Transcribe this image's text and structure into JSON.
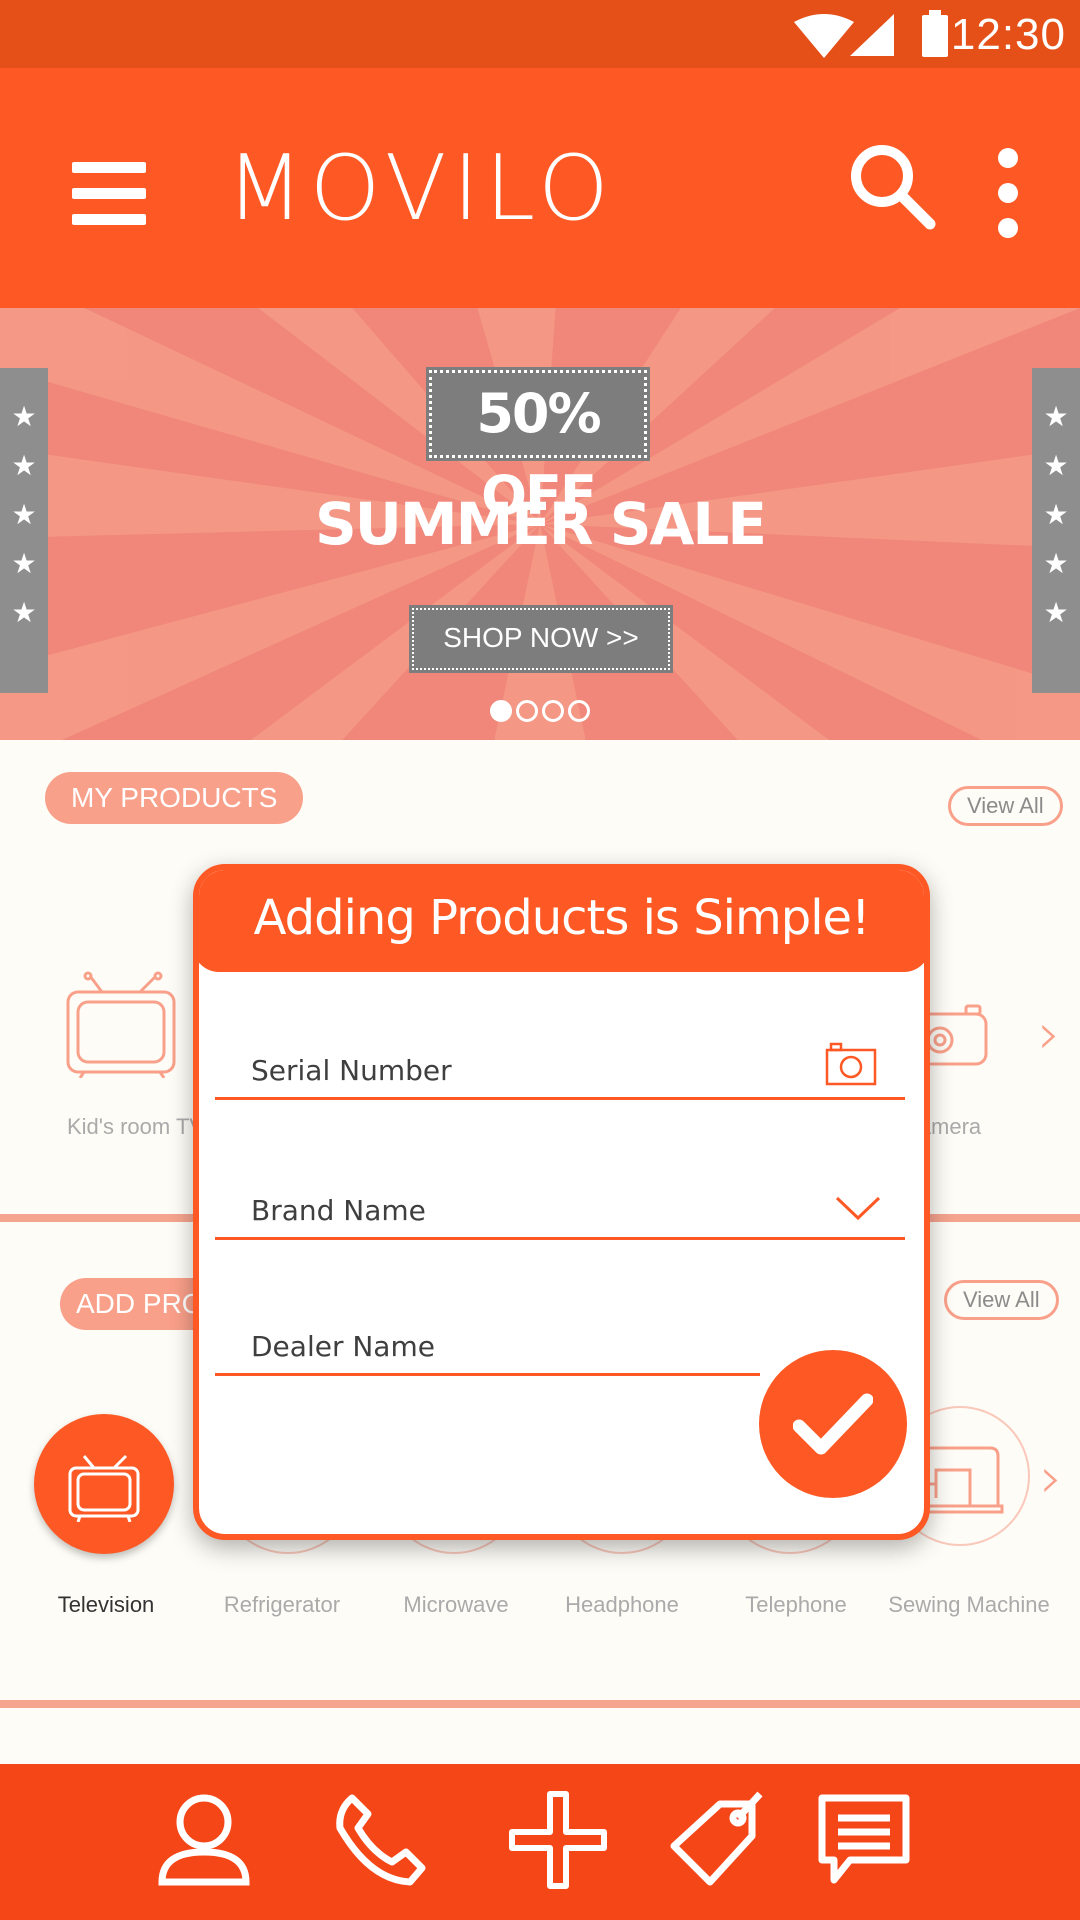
{
  "status_bar": {
    "time": "12:30",
    "icons": [
      "wifi-icon",
      "signal-icon",
      "battery-icon"
    ]
  },
  "app_bar": {
    "title": "MOVILO",
    "icons": [
      "menu-icon",
      "search-icon",
      "overflow-menu-icon"
    ]
  },
  "banner": {
    "offer": "50% OFF",
    "title": "SUMMER SALE",
    "cta": "SHOP NOW >>",
    "stars": "★ ★ ★ ★ ★",
    "page_count": 4,
    "active_page": 1
  },
  "my_products": {
    "title": "MY PRODUCTS",
    "view_all": "View All",
    "items": [
      {
        "label": "Kid's room TV",
        "icon": "tv-icon"
      },
      {
        "label": "amera",
        "icon": "camera-icon"
      }
    ]
  },
  "add_products": {
    "title": "ADD PROD",
    "view_all": "View All",
    "categories": [
      {
        "label": "Television",
        "icon": "tv-icon",
        "active": true
      },
      {
        "label": "Refrigerator",
        "icon": "refrigerator-icon"
      },
      {
        "label": "Microwave",
        "icon": "microwave-icon"
      },
      {
        "label": "Headphone",
        "icon": "headphone-icon"
      },
      {
        "label": "Telephone",
        "icon": "telephone-icon"
      },
      {
        "label": "Sewing Machine",
        "icon": "sewing-machine-icon"
      }
    ]
  },
  "dialog": {
    "title": "Adding Products is Simple!",
    "fields": {
      "serial": "Serial Number",
      "brand": "Brand Name",
      "dealer": "Dealer Name"
    }
  },
  "bottom_nav": {
    "items": [
      "profile-icon",
      "phone-icon",
      "add-icon",
      "tag-icon",
      "chat-icon"
    ]
  },
  "colors": {
    "primary": "#fe5824",
    "status_bar": "#e55019",
    "accent_light": "#f9a08a",
    "banner": "#f0877a",
    "bottom_nav": "#f44617"
  }
}
